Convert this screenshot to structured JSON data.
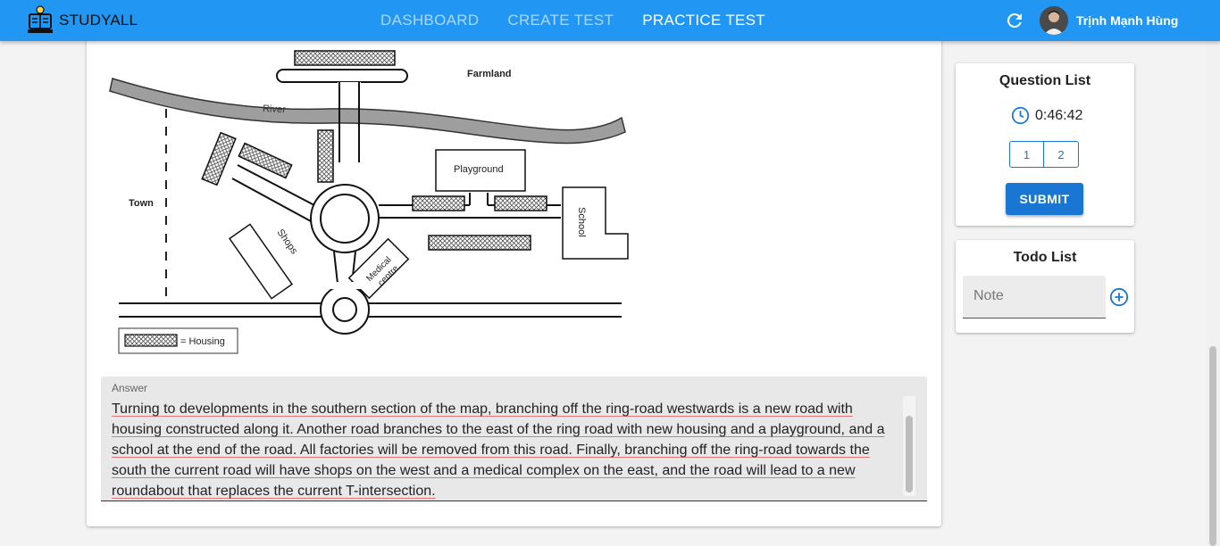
{
  "app": {
    "name": "STUDYALL"
  },
  "nav": {
    "items": [
      {
        "label": "DASHBOARD"
      },
      {
        "label": "CREATE TEST"
      },
      {
        "label": "PRACTICE TEST"
      }
    ],
    "active_index": 2
  },
  "user": {
    "name": "Trịnh Mạnh Hùng"
  },
  "map": {
    "labels": {
      "farmland": "Farmland",
      "river": "River",
      "town": "Town",
      "playground": "Playground",
      "school": "School",
      "shops": "Shops",
      "medical_line1": "Medical",
      "medical_line2": "centre",
      "legend_housing": "= Housing"
    }
  },
  "answer": {
    "label": "Answer",
    "text": "Turning to developments in the southern section of the map, branching off the ring-road westwards is a new road with housing constructed along it. Another road branches to the east of the ring road with new housing and a playground, and a school at the end of the road. All factories will be removed from this road. Finally, branching off the ring-road towards the south the current road will have shops on the west and a medical complex on the east, and the road will lead to a new roundabout that replaces the current T-intersection."
  },
  "question_list": {
    "title": "Question List",
    "timer": "0:46:42",
    "questions": [
      "1",
      "2"
    ],
    "submit_label": "SUBMIT"
  },
  "todo": {
    "title": "Todo List",
    "placeholder": "Note"
  },
  "colors": {
    "topbar": "#2196f3",
    "primary": "#1976d2",
    "spellcheck_underline": "#e57373"
  }
}
